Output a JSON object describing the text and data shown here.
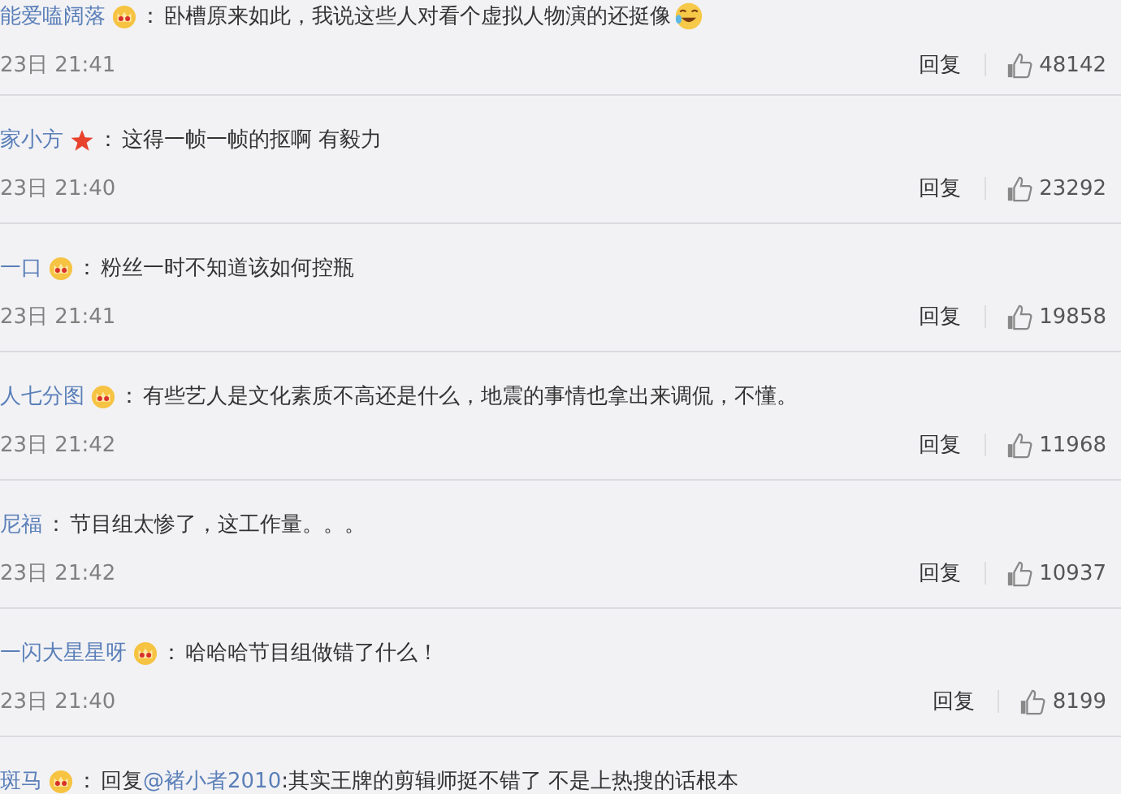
{
  "comments": [
    {
      "user": "能爱嗑阔落",
      "badge": {
        "kind": "crown"
      },
      "separator": "：",
      "text": "卧槽原来如此，我说这些人对看个虚拟人物演的还挺像",
      "emoji": {
        "kind": "laugh"
      },
      "time": "23日 21:41",
      "reply": "回复",
      "likes": "48142"
    },
    {
      "user": "家小方",
      "badge": {
        "kind": "star"
      },
      "separator": "：",
      "text": "这得一帧一帧的抠啊 有毅力",
      "time": "23日 21:40",
      "reply": "回复",
      "likes": "23292"
    },
    {
      "user": "一口",
      "badge": {
        "kind": "crown"
      },
      "separator": "：",
      "text": "粉丝一时不知道该如何控瓶",
      "time": "23日 21:41",
      "reply": "回复",
      "likes": "19858"
    },
    {
      "user": "人七分图",
      "badge": {
        "kind": "crown"
      },
      "separator": "：",
      "text": "有些艺人是文化素质不高还是什么，地震的事情也拿出来调侃，不懂。",
      "time": "23日 21:42",
      "reply": "回复",
      "likes": "11968"
    },
    {
      "user": "尼福",
      "separator": "：",
      "text": "节目组太惨了，这工作量。。。",
      "time": "23日 21:42",
      "reply": "回复",
      "likes": "10937"
    },
    {
      "user": "一闪大星星呀",
      "badge": {
        "kind": "crown"
      },
      "separator": "：",
      "text": "哈哈哈节目组做错了什么！",
      "time": "23日 21:40",
      "reply": "回复",
      "likes": "8199"
    },
    {
      "user": "斑马",
      "badge": {
        "kind": "crown"
      },
      "separator": "：",
      "reply_prefix": "回复",
      "mention": "@褚小者2010",
      "text": ":其实王牌的剪辑师挺不错了 不是上热搜的话根本"
    }
  ]
}
